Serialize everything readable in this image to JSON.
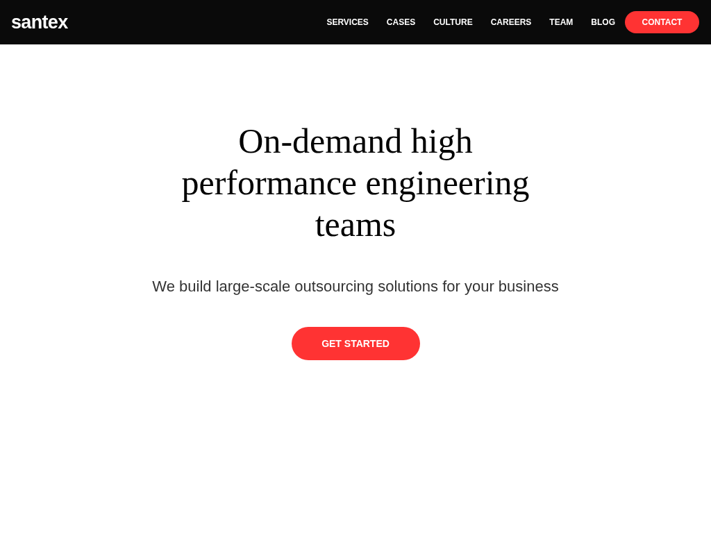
{
  "header": {
    "logo": "santex",
    "nav": [
      "SERVICES",
      "CASES",
      "CULTURE",
      "CAREERS",
      "TEAM",
      "BLOG"
    ],
    "contact_button": "CONTACT"
  },
  "hero": {
    "heading": "On-demand high performance engineering teams",
    "subheading": "We build large-scale outsourcing solutions for your business",
    "cta_button": "GET STARTED"
  }
}
